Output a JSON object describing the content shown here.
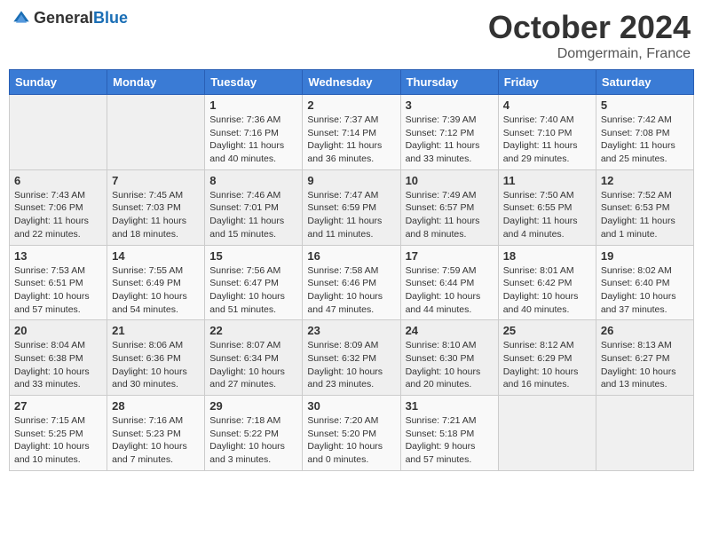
{
  "header": {
    "logo_general": "General",
    "logo_blue": "Blue",
    "month": "October 2024",
    "location": "Domgermain, France"
  },
  "weekdays": [
    "Sunday",
    "Monday",
    "Tuesday",
    "Wednesday",
    "Thursday",
    "Friday",
    "Saturday"
  ],
  "weeks": [
    [
      {
        "day": "",
        "info": ""
      },
      {
        "day": "",
        "info": ""
      },
      {
        "day": "1",
        "info": "Sunrise: 7:36 AM\nSunset: 7:16 PM\nDaylight: 11 hours and 40 minutes."
      },
      {
        "day": "2",
        "info": "Sunrise: 7:37 AM\nSunset: 7:14 PM\nDaylight: 11 hours and 36 minutes."
      },
      {
        "day": "3",
        "info": "Sunrise: 7:39 AM\nSunset: 7:12 PM\nDaylight: 11 hours and 33 minutes."
      },
      {
        "day": "4",
        "info": "Sunrise: 7:40 AM\nSunset: 7:10 PM\nDaylight: 11 hours and 29 minutes."
      },
      {
        "day": "5",
        "info": "Sunrise: 7:42 AM\nSunset: 7:08 PM\nDaylight: 11 hours and 25 minutes."
      }
    ],
    [
      {
        "day": "6",
        "info": "Sunrise: 7:43 AM\nSunset: 7:06 PM\nDaylight: 11 hours and 22 minutes."
      },
      {
        "day": "7",
        "info": "Sunrise: 7:45 AM\nSunset: 7:03 PM\nDaylight: 11 hours and 18 minutes."
      },
      {
        "day": "8",
        "info": "Sunrise: 7:46 AM\nSunset: 7:01 PM\nDaylight: 11 hours and 15 minutes."
      },
      {
        "day": "9",
        "info": "Sunrise: 7:47 AM\nSunset: 6:59 PM\nDaylight: 11 hours and 11 minutes."
      },
      {
        "day": "10",
        "info": "Sunrise: 7:49 AM\nSunset: 6:57 PM\nDaylight: 11 hours and 8 minutes."
      },
      {
        "day": "11",
        "info": "Sunrise: 7:50 AM\nSunset: 6:55 PM\nDaylight: 11 hours and 4 minutes."
      },
      {
        "day": "12",
        "info": "Sunrise: 7:52 AM\nSunset: 6:53 PM\nDaylight: 11 hours and 1 minute."
      }
    ],
    [
      {
        "day": "13",
        "info": "Sunrise: 7:53 AM\nSunset: 6:51 PM\nDaylight: 10 hours and 57 minutes."
      },
      {
        "day": "14",
        "info": "Sunrise: 7:55 AM\nSunset: 6:49 PM\nDaylight: 10 hours and 54 minutes."
      },
      {
        "day": "15",
        "info": "Sunrise: 7:56 AM\nSunset: 6:47 PM\nDaylight: 10 hours and 51 minutes."
      },
      {
        "day": "16",
        "info": "Sunrise: 7:58 AM\nSunset: 6:46 PM\nDaylight: 10 hours and 47 minutes."
      },
      {
        "day": "17",
        "info": "Sunrise: 7:59 AM\nSunset: 6:44 PM\nDaylight: 10 hours and 44 minutes."
      },
      {
        "day": "18",
        "info": "Sunrise: 8:01 AM\nSunset: 6:42 PM\nDaylight: 10 hours and 40 minutes."
      },
      {
        "day": "19",
        "info": "Sunrise: 8:02 AM\nSunset: 6:40 PM\nDaylight: 10 hours and 37 minutes."
      }
    ],
    [
      {
        "day": "20",
        "info": "Sunrise: 8:04 AM\nSunset: 6:38 PM\nDaylight: 10 hours and 33 minutes."
      },
      {
        "day": "21",
        "info": "Sunrise: 8:06 AM\nSunset: 6:36 PM\nDaylight: 10 hours and 30 minutes."
      },
      {
        "day": "22",
        "info": "Sunrise: 8:07 AM\nSunset: 6:34 PM\nDaylight: 10 hours and 27 minutes."
      },
      {
        "day": "23",
        "info": "Sunrise: 8:09 AM\nSunset: 6:32 PM\nDaylight: 10 hours and 23 minutes."
      },
      {
        "day": "24",
        "info": "Sunrise: 8:10 AM\nSunset: 6:30 PM\nDaylight: 10 hours and 20 minutes."
      },
      {
        "day": "25",
        "info": "Sunrise: 8:12 AM\nSunset: 6:29 PM\nDaylight: 10 hours and 16 minutes."
      },
      {
        "day": "26",
        "info": "Sunrise: 8:13 AM\nSunset: 6:27 PM\nDaylight: 10 hours and 13 minutes."
      }
    ],
    [
      {
        "day": "27",
        "info": "Sunrise: 7:15 AM\nSunset: 5:25 PM\nDaylight: 10 hours and 10 minutes."
      },
      {
        "day": "28",
        "info": "Sunrise: 7:16 AM\nSunset: 5:23 PM\nDaylight: 10 hours and 7 minutes."
      },
      {
        "day": "29",
        "info": "Sunrise: 7:18 AM\nSunset: 5:22 PM\nDaylight: 10 hours and 3 minutes."
      },
      {
        "day": "30",
        "info": "Sunrise: 7:20 AM\nSunset: 5:20 PM\nDaylight: 10 hours and 0 minutes."
      },
      {
        "day": "31",
        "info": "Sunrise: 7:21 AM\nSunset: 5:18 PM\nDaylight: 9 hours and 57 minutes."
      },
      {
        "day": "",
        "info": ""
      },
      {
        "day": "",
        "info": ""
      }
    ]
  ]
}
